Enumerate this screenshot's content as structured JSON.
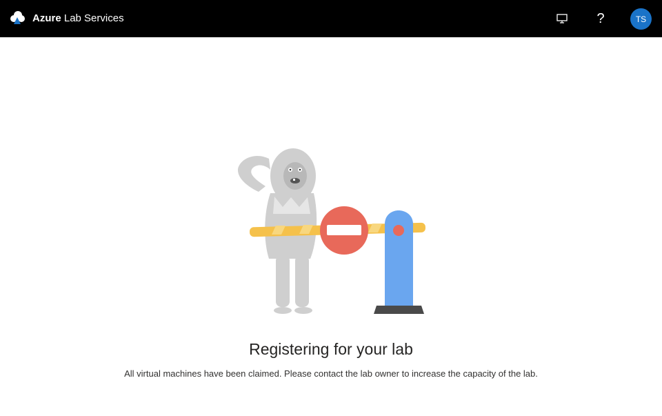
{
  "header": {
    "brand": "Azure",
    "product": "Lab Services",
    "user_initials": "TS",
    "icons": [
      "azure-lab-logo-icon",
      "monitor-icon",
      "help-icon"
    ],
    "help_glyph": "?",
    "background_color": "#000000",
    "avatar_color": "#1a73c8"
  },
  "main": {
    "illustration": "yeti-barrier-illustration",
    "heading": "Registering for your lab",
    "message": "All virtual machines have been claimed. Please contact the lab owner to increase the capacity of the lab."
  },
  "colors": {
    "stop_sign": "#e8695a",
    "barrier_arm": "#f5c14b",
    "post": "#6aa6ef",
    "yeti": "#cfcfcf"
  }
}
